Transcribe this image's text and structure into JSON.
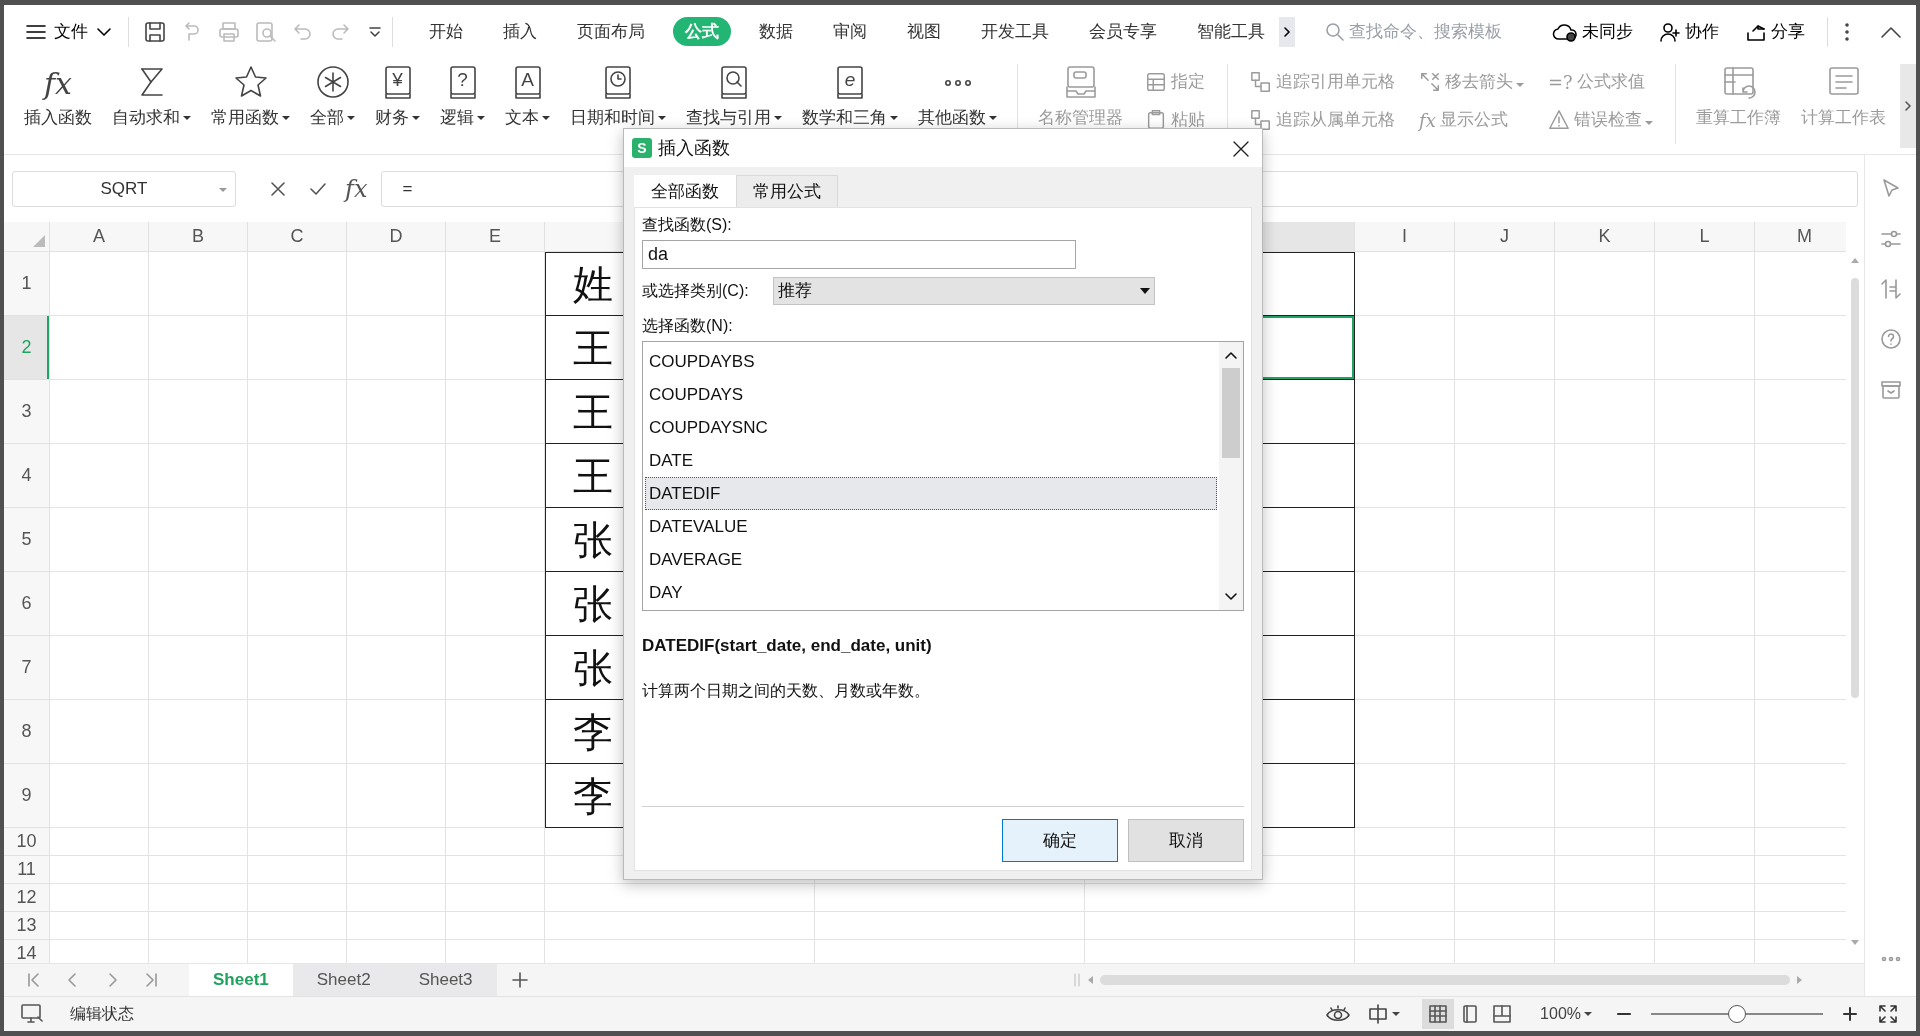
{
  "top_bar": {
    "file_menu": "文件",
    "tabs": [
      {
        "label": "开始",
        "selected": false
      },
      {
        "label": "插入",
        "selected": false
      },
      {
        "label": "页面布局",
        "selected": false
      },
      {
        "label": "公式",
        "selected": true
      },
      {
        "label": "数据",
        "selected": false
      },
      {
        "label": "审阅",
        "selected": false
      },
      {
        "label": "视图",
        "selected": false
      },
      {
        "label": "开发工具",
        "selected": false
      },
      {
        "label": "会员专享",
        "selected": false
      },
      {
        "label": "智能工具",
        "selected": false
      }
    ],
    "search": {
      "placeholder": "查找命令、搜索模板"
    },
    "sync": "未同步",
    "collaborate": "协作",
    "share": "分享"
  },
  "ribbon": [
    {
      "kind": "large",
      "glyph": "fx",
      "label": "插入函数",
      "dropdown": false,
      "disabled": false
    },
    {
      "kind": "large",
      "label": "自动求和",
      "dropdown": true,
      "disabled": false
    },
    {
      "kind": "large",
      "label": "常用函数",
      "dropdown": true,
      "disabled": false
    },
    {
      "kind": "large",
      "label": "全部",
      "dropdown": true,
      "disabled": false
    },
    {
      "kind": "large",
      "glyph": "¥",
      "label": "财务",
      "dropdown": true,
      "disabled": false
    },
    {
      "kind": "large",
      "glyph": "?",
      "label": "逻辑",
      "dropdown": true,
      "disabled": false
    },
    {
      "kind": "large",
      "glyph": "A",
      "label": "文本",
      "dropdown": true,
      "disabled": false
    },
    {
      "kind": "large",
      "label": "日期和时间",
      "dropdown": true,
      "disabled": false
    },
    {
      "kind": "large",
      "label": "查找与引用",
      "dropdown": true,
      "disabled": false
    },
    {
      "kind": "large",
      "glyph": "e",
      "label": "数学和三角",
      "dropdown": true,
      "disabled": false
    },
    {
      "kind": "large",
      "label": "其他函数",
      "dropdown": true,
      "disabled": false
    },
    {
      "kind": "divider"
    },
    {
      "kind": "large",
      "label": "名称管理器",
      "dropdown": false,
      "disabled": true
    },
    {
      "kind": "stack",
      "items": [
        {
          "label": "指定",
          "dropdown": false,
          "disabled": true
        },
        {
          "label": "粘贴",
          "dropdown": false,
          "disabled": true
        }
      ]
    },
    {
      "kind": "divider"
    },
    {
      "kind": "stack",
      "items": [
        {
          "label": "追踪引用单元格",
          "dropdown": false,
          "disabled": true
        },
        {
          "label": "追踪从属单元格",
          "dropdown": false,
          "disabled": true
        }
      ]
    },
    {
      "kind": "stack",
      "items": [
        {
          "label": "移去箭头",
          "dropdown": true,
          "disabled": true
        },
        {
          "glyph": "fx",
          "label": "显示公式",
          "dropdown": false,
          "disabled": true
        }
      ]
    },
    {
      "kind": "stack",
      "items": [
        {
          "glyph": "=?",
          "label": "公式求值",
          "dropdown": false,
          "disabled": true
        },
        {
          "label": "错误检查",
          "dropdown": true,
          "disabled": true
        }
      ]
    },
    {
      "kind": "divider"
    },
    {
      "kind": "large",
      "label": "重算工作簿",
      "dropdown": false,
      "disabled": true
    },
    {
      "kind": "large",
      "label": "计算工作表",
      "dropdown": false,
      "disabled": true
    }
  ],
  "formula_bar": {
    "name_box": "SQRT",
    "fx": "fx",
    "value": "="
  },
  "sheet": {
    "columns": [
      {
        "label": "A",
        "selected": false
      },
      {
        "label": "B",
        "selected": false
      },
      {
        "label": "C",
        "selected": false
      },
      {
        "label": "D",
        "selected": false
      },
      {
        "label": "E",
        "selected": false
      },
      {
        "selected": true
      },
      {
        "label": "I",
        "selected": false
      },
      {
        "label": "J",
        "selected": false
      },
      {
        "label": "K",
        "selected": false
      },
      {
        "label": "L",
        "selected": false
      },
      {
        "label": "M",
        "selected": false
      }
    ],
    "rows": [
      {
        "label": "1",
        "selected": false,
        "cells": [
          {
            "kind": "text",
            "text": "姓"
          },
          {
            "kind": "blank"
          }
        ]
      },
      {
        "label": "2",
        "selected": true,
        "cells": [
          {
            "kind": "text",
            "text": "王"
          },
          {
            "kind": "blank"
          }
        ]
      },
      {
        "label": "3",
        "selected": false,
        "cells": [
          {
            "kind": "text",
            "text": "王"
          },
          {
            "kind": "blank"
          }
        ]
      },
      {
        "label": "4",
        "selected": false,
        "cells": [
          {
            "kind": "text",
            "text": "王"
          },
          {
            "kind": "blank"
          }
        ]
      },
      {
        "label": "5",
        "selected": false,
        "cells": [
          {
            "kind": "text",
            "text": "张"
          },
          {
            "kind": "blank"
          }
        ]
      },
      {
        "label": "6",
        "selected": false,
        "cells": [
          {
            "kind": "text",
            "text": "张"
          },
          {
            "kind": "blank"
          }
        ]
      },
      {
        "label": "7",
        "selected": false,
        "cells": [
          {
            "kind": "text",
            "text": "张"
          },
          {
            "kind": "blank"
          }
        ]
      },
      {
        "label": "8",
        "selected": false,
        "cells": [
          {
            "kind": "text",
            "text": "李"
          },
          {
            "kind": "blank"
          }
        ]
      },
      {
        "label": "9",
        "selected": false,
        "cells": [
          {
            "kind": "text",
            "text": "李"
          },
          {
            "kind": "blank"
          }
        ]
      },
      {
        "label": "10",
        "selected": false
      },
      {
        "label": "11",
        "selected": false
      },
      {
        "label": "12",
        "selected": false
      },
      {
        "label": "13",
        "selected": false
      },
      {
        "label": "14",
        "selected": false
      }
    ]
  },
  "sheet_tabs": [
    {
      "label": "Sheet1",
      "selected": true
    },
    {
      "label": "Sheet2",
      "selected": false
    },
    {
      "label": "Sheet3",
      "selected": false
    }
  ],
  "status_bar": {
    "mode": "编辑状态",
    "zoom": "100%",
    "zoom_slider": {
      "level": 0.5
    },
    "views": [
      {
        "selected": true
      },
      {
        "selected": false
      },
      {
        "selected": false
      }
    ]
  },
  "dialog": {
    "app_glyph": "S",
    "title": "插入函数",
    "tabs": [
      {
        "label": "全部函数",
        "selected": true
      },
      {
        "label": "常用公式",
        "selected": false
      }
    ],
    "search_label": "查找函数(S):",
    "search_value": "da",
    "category_label": "或选择类别(C):",
    "category_value": "推荐",
    "list_label": "选择函数(N):",
    "functions": [
      {
        "name": "COUPDAYBS",
        "selected": false
      },
      {
        "name": "COUPDAYS",
        "selected": false
      },
      {
        "name": "COUPDAYSNC",
        "selected": false
      },
      {
        "name": "DATE",
        "selected": false
      },
      {
        "name": "DATEDIF",
        "selected": true
      },
      {
        "name": "DATEVALUE",
        "selected": false
      },
      {
        "name": "DAVERAGE",
        "selected": false
      },
      {
        "name": "DAY",
        "selected": false
      }
    ],
    "signature": "DATEDIF(start_date, end_date, unit)",
    "description": "计算两个日期之间的天数、月数或年数。",
    "buttons": [
      {
        "label": "确定",
        "kind": "primary"
      },
      {
        "label": "取消",
        "kind": "secondary"
      }
    ]
  }
}
